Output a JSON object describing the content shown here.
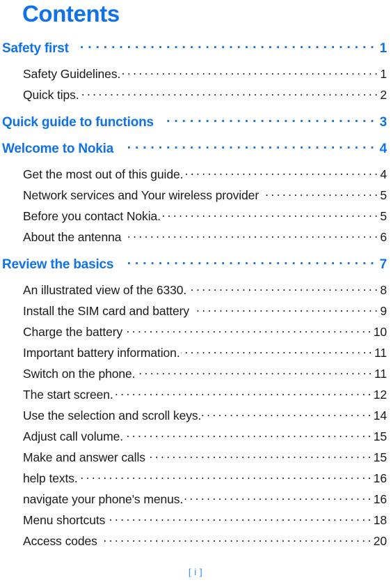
{
  "document": {
    "title": "Contents",
    "accent_color": "#0f72e8",
    "body_color": "#1a1a1a",
    "folio_color": "#2f86f0"
  },
  "toc": {
    "entries": [
      {
        "level": 1,
        "label": "Safety first",
        "page": "1",
        "group_top": false
      },
      {
        "level": 2,
        "label": "Safety Guidelines.",
        "page": "1",
        "group_top": false
      },
      {
        "level": 2,
        "label": "Quick tips.",
        "page": "2",
        "group_top": false
      },
      {
        "level": 1,
        "label": "Quick guide to functions",
        "page": "3",
        "group_top": true
      },
      {
        "level": 1,
        "label": "Welcome to Nokia",
        "page": "4",
        "group_top": false
      },
      {
        "level": 2,
        "label": "Get the most out of this guide.",
        "page": "4",
        "group_top": false
      },
      {
        "level": 2,
        "label": "Network services and Your wireless provider",
        "page": "5",
        "group_top": false
      },
      {
        "level": 2,
        "label": "Before you contact Nokia.",
        "page": "5",
        "group_top": false
      },
      {
        "level": 2,
        "label": "About the antenna",
        "page": "6",
        "group_top": false
      },
      {
        "level": 1,
        "label": "Review the basics",
        "page": "7",
        "group_top": true
      },
      {
        "level": 2,
        "label": "An illustrated view of the 6330.",
        "page": "8",
        "group_top": false
      },
      {
        "level": 2,
        "label": "Install the SIM card and battery",
        "page": "9",
        "group_top": false
      },
      {
        "level": 2,
        "label": "Charge the battery",
        "page": "10",
        "group_top": false
      },
      {
        "level": 2,
        "label": "Important battery information.",
        "page": "11",
        "group_top": false
      },
      {
        "level": 2,
        "label": "Switch on the phone.",
        "page": "11",
        "group_top": false
      },
      {
        "level": 2,
        "label": "The start screen.",
        "page": "12",
        "group_top": false
      },
      {
        "level": 2,
        "label": "Use the selection and scroll keys.",
        "page": "14",
        "group_top": false
      },
      {
        "level": 2,
        "label": "Adjust call volume.",
        "page": "15",
        "group_top": false
      },
      {
        "level": 2,
        "label": "Make and answer calls",
        "page": "15",
        "group_top": false
      },
      {
        "level": 2,
        "label": "help texts.",
        "page": "16",
        "group_top": false
      },
      {
        "level": 2,
        "label": "navigate your phone's menus.",
        "page": "16",
        "group_top": false
      },
      {
        "level": 2,
        "label": "Menu shortcuts",
        "page": "18",
        "group_top": false
      },
      {
        "level": 2,
        "label": "Access codes",
        "page": "20",
        "group_top": false
      }
    ]
  },
  "footer": {
    "folio": "[ i ]"
  }
}
